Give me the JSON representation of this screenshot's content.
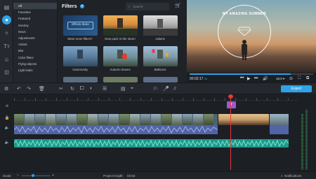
{
  "tools": [
    {
      "icon": "folder-icon",
      "glyph": "▤"
    },
    {
      "icon": "filters-icon",
      "glyph": "●"
    },
    {
      "icon": "effects-icon",
      "glyph": "✧"
    },
    {
      "icon": "titles-icon",
      "glyph": "Tт"
    },
    {
      "icon": "stickers-icon",
      "glyph": "☺"
    },
    {
      "icon": "transitions-icon",
      "glyph": "⊡"
    },
    {
      "icon": "more-icon",
      "glyph": "⊞"
    }
  ],
  "categories": [
    "All",
    "Favorites",
    "Featured",
    "Overlay",
    "News",
    "Adjustments",
    "Artistic",
    "Blur",
    "Color filters",
    "Flying objects",
    "Light leaks"
  ],
  "filters_panel": {
    "title": "Filters",
    "help": "?",
    "search_placeholder": "Search",
    "cart_icon": "cart-icon",
    "tiles": [
      {
        "label": "Want more filters?",
        "button_text": "Effects Store"
      },
      {
        "label": "New pack in the store!"
      },
      {
        "label": "Adams"
      },
      {
        "label": "Aivazovsky"
      },
      {
        "label": "Autumn leaves"
      },
      {
        "label": "Balloons"
      }
    ]
  },
  "preview": {
    "overlay_text": "MY AMAZING SUMMER",
    "timecode": "00:02:17",
    "timecode_frac": ".25",
    "progress": 0.82,
    "zoom": "16:9 ▾"
  },
  "toolbar": {
    "export_label": "Export"
  },
  "timeline": {
    "title_clip_label": "T",
    "playhead_icon": "playhead-icon"
  },
  "status": {
    "scale_label": "Scale:",
    "project_length_label": "Project length:",
    "project_length": "02:53",
    "notifications_label": "Notifications"
  },
  "colors": {
    "accent": "#2fa3e6",
    "playhead": "#e23b3b",
    "music_track": "#1c9a8a",
    "title_clip": "#9b59d0"
  }
}
